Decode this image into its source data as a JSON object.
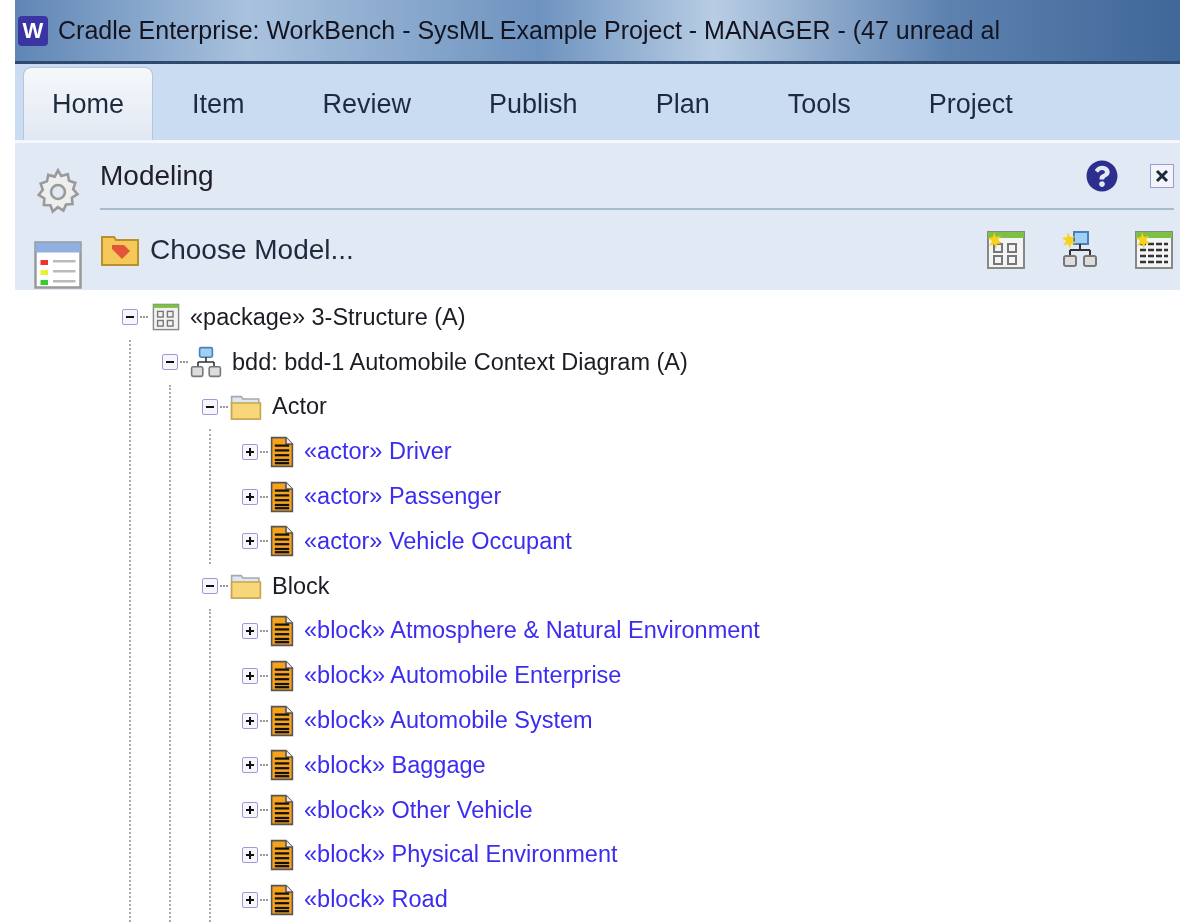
{
  "window": {
    "icon_letter": "W",
    "title": "Cradle Enterprise: WorkBench - SysML Example Project - MANAGER - (47 unread al"
  },
  "tabs": [
    {
      "label": "Home",
      "selected": true
    },
    {
      "label": "Item",
      "selected": false
    },
    {
      "label": "Review",
      "selected": false
    },
    {
      "label": "Publish",
      "selected": false
    },
    {
      "label": "Plan",
      "selected": false
    },
    {
      "label": "Tools",
      "selected": false
    },
    {
      "label": "Project",
      "selected": false
    }
  ],
  "panel": {
    "title": "Modeling",
    "command": "Choose Model..."
  },
  "tree": [
    {
      "kind": "package",
      "label": "«package» 3-Structure (A)",
      "expanded": true,
      "children": [
        {
          "kind": "diagram",
          "label": "bdd: bdd-1 Automobile Context Diagram (A)",
          "expanded": true,
          "children": [
            {
              "kind": "folder",
              "label": "Actor",
              "expanded": true,
              "children": [
                {
                  "kind": "element",
                  "label": "«actor» Driver",
                  "expanded": false
                },
                {
                  "kind": "element",
                  "label": "«actor» Passenger",
                  "expanded": false
                },
                {
                  "kind": "element",
                  "label": "«actor» Vehicle Occupant",
                  "expanded": false
                }
              ]
            },
            {
              "kind": "folder",
              "label": "Block",
              "expanded": true,
              "children": [
                {
                  "kind": "element",
                  "label": "«block» Atmosphere & Natural Environment",
                  "expanded": false
                },
                {
                  "kind": "element",
                  "label": "«block» Automobile Enterprise",
                  "expanded": false
                },
                {
                  "kind": "element",
                  "label": "«block» Automobile System",
                  "expanded": false
                },
                {
                  "kind": "element",
                  "label": "«block» Baggage",
                  "expanded": false
                },
                {
                  "kind": "element",
                  "label": "«block» Other Vehicle",
                  "expanded": false
                },
                {
                  "kind": "element",
                  "label": "«block» Physical Environment",
                  "expanded": false
                },
                {
                  "kind": "element",
                  "label": "«block» Road",
                  "expanded": false
                }
              ]
            }
          ]
        }
      ]
    }
  ]
}
